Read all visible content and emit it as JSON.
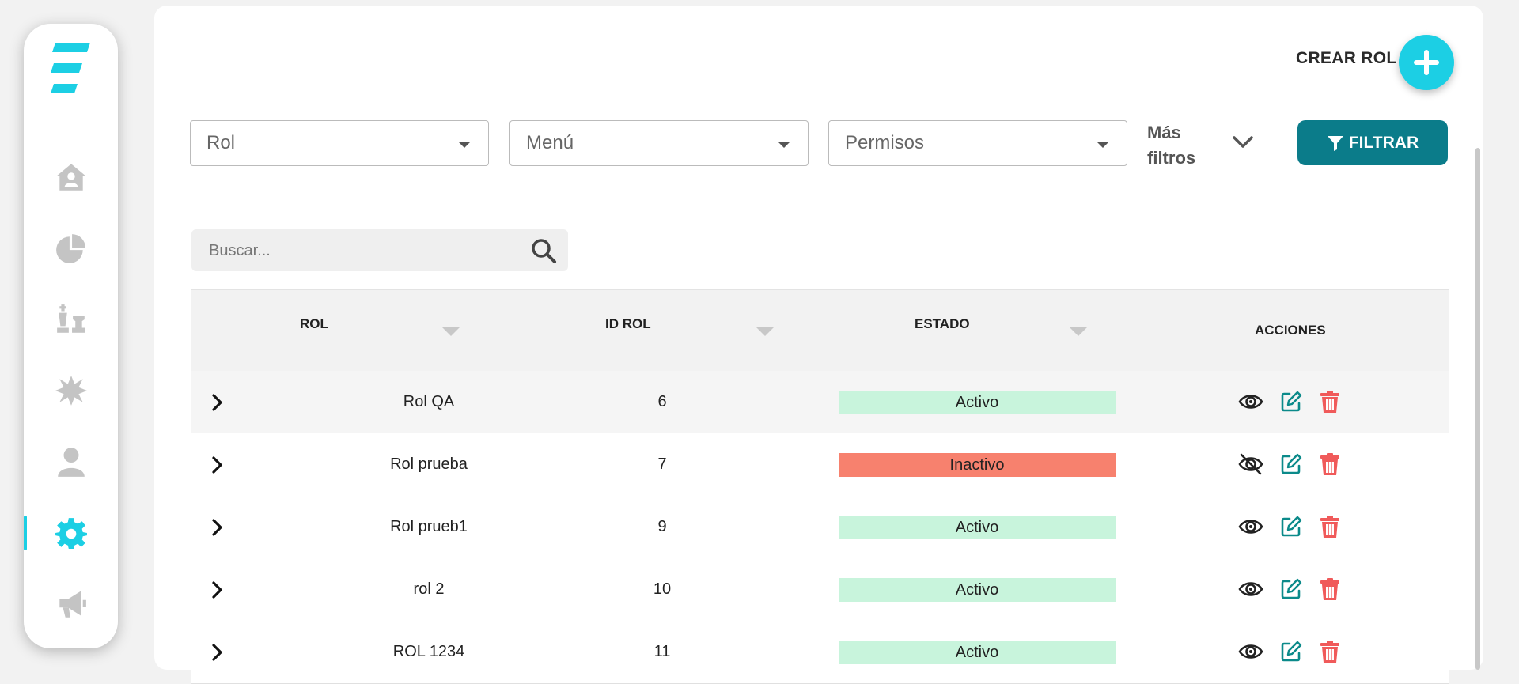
{
  "header": {
    "create_label": "CREAR ROL"
  },
  "filters": {
    "rol_placeholder": "Rol",
    "menu_placeholder": "Menú",
    "permisos_placeholder": "Permisos",
    "more_filters_label": "Más filtros",
    "filter_button_label": "FILTRAR"
  },
  "search": {
    "placeholder": "Buscar..."
  },
  "table": {
    "columns": [
      "ROL",
      "ID ROL",
      "ESTADO",
      "ACCIONES"
    ],
    "rows": [
      {
        "rol": "Rol QA",
        "id": "6",
        "estado": "Activo"
      },
      {
        "rol": "Rol prueba",
        "id": "7",
        "estado": "Inactivo"
      },
      {
        "rol": "Rol prueb1",
        "id": "9",
        "estado": "Activo"
      },
      {
        "rol": "rol 2",
        "id": "10",
        "estado": "Activo"
      },
      {
        "rol": "ROL 1234",
        "id": "11",
        "estado": "Activo"
      }
    ]
  },
  "colors": {
    "accent": "#1ccfe4",
    "primary_dark": "#0b7c8a",
    "active_bg": "#c8f4dc",
    "inactive_bg": "#f7816e",
    "delete_red": "#f05a5a"
  },
  "sidebar": {
    "items": [
      {
        "icon": "home-icon",
        "active": false
      },
      {
        "icon": "pie-chart-icon",
        "active": false
      },
      {
        "icon": "chess-icon",
        "active": false
      },
      {
        "icon": "starburst-icon",
        "active": false
      },
      {
        "icon": "user-icon",
        "active": false
      },
      {
        "icon": "gear-icon",
        "active": true
      },
      {
        "icon": "megaphone-icon",
        "active": false
      }
    ]
  }
}
